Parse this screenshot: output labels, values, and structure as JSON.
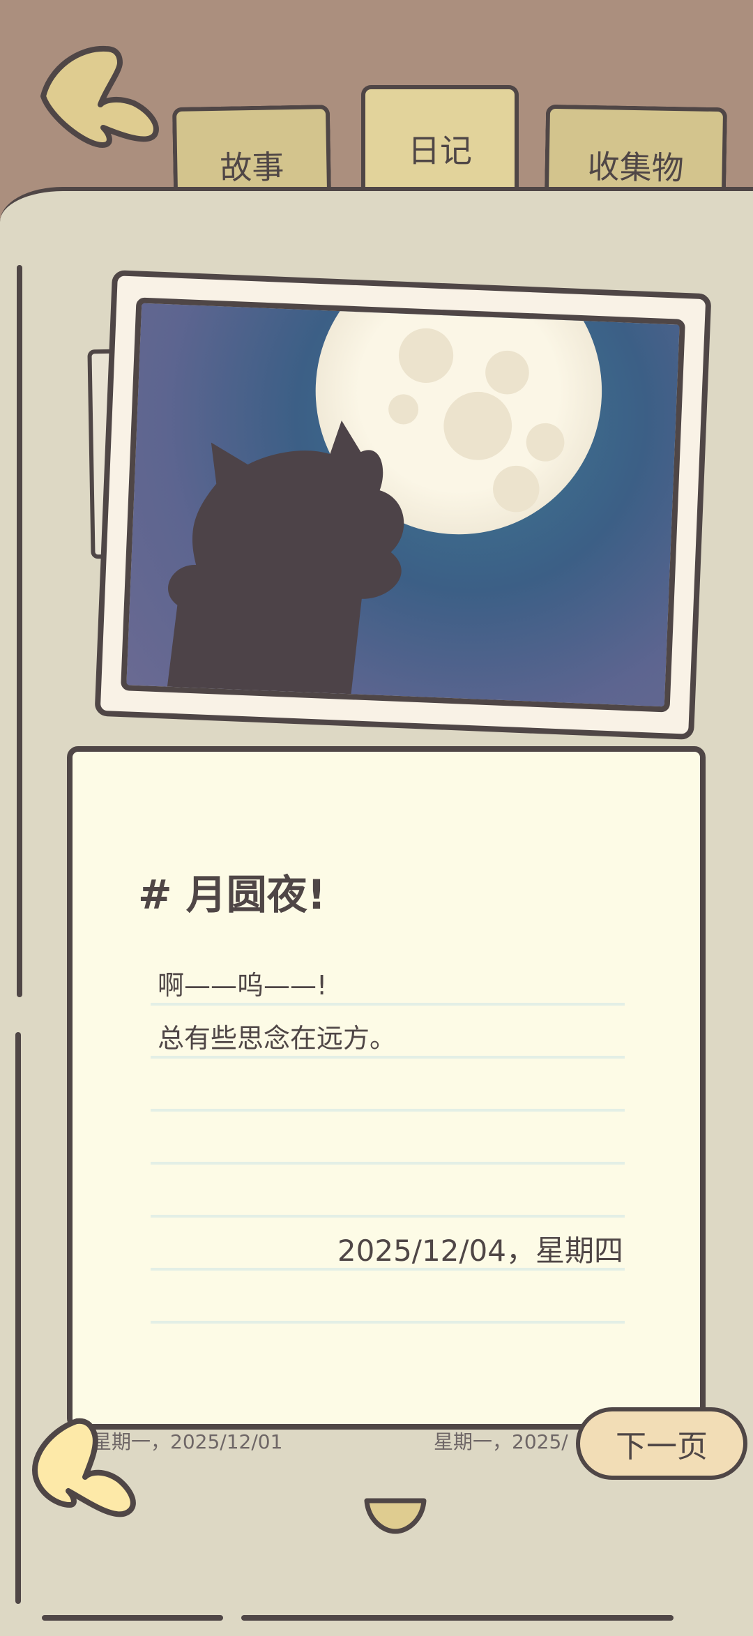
{
  "tabs": [
    {
      "label": "故事"
    },
    {
      "label": "日记"
    },
    {
      "label": "收集物"
    }
  ],
  "entry": {
    "title": "# 月圆夜!",
    "lines": [
      "啊——呜——!",
      "总有些思念在远方。"
    ],
    "date": "2025/12/04，星期四"
  },
  "behind_page_dates": {
    "left": "星期一，2025/12/01",
    "right": "星期一，2025/"
  },
  "buttons": {
    "next_page": "下一页"
  },
  "colors": {
    "outline": "#4f4646",
    "top_bar": "#ab8f7e",
    "page": "#ddd8c4",
    "tab": "#d3c48d",
    "card": "#fdfbe6",
    "back_arrow": "#dfcc90"
  },
  "icons": {
    "back": "curved-back-arrow-icon",
    "prev_page": "curved-back-arrow-icon",
    "scroll_down": "down-chevron-icon"
  }
}
